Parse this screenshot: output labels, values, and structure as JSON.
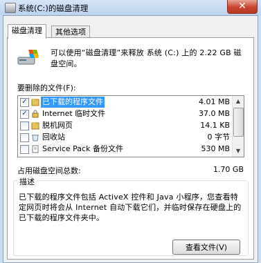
{
  "window": {
    "title": "系统(C:)的磁盘清理",
    "close_glyph": "✕"
  },
  "tabs": [
    {
      "label": "磁盘清理",
      "active": true
    },
    {
      "label": "其他选项",
      "active": false
    }
  ],
  "intro_text": "可以使用“磁盘清理”来释放 系统 (C:) 上的 2.22 GB 磁盘空间。",
  "files_label": "要删除的文件(F):",
  "files": [
    {
      "checked": true,
      "name": "已下载的程序文件",
      "size": "4.01 MB",
      "selected": true,
      "icon": "folder-icon"
    },
    {
      "checked": true,
      "name": "Internet 临时文件",
      "size": "37.0 MB",
      "selected": false,
      "icon": "lock-icon"
    },
    {
      "checked": false,
      "name": "脱机网页",
      "size": "14.1 KB",
      "selected": false,
      "icon": "folder-icon"
    },
    {
      "checked": false,
      "name": "回收站",
      "size": "0 字节",
      "selected": false,
      "icon": "recycle-bin-icon"
    },
    {
      "checked": false,
      "name": "Service Pack 备份文件",
      "size": "530 MB",
      "selected": false,
      "icon": "document-icon"
    }
  ],
  "total": {
    "label": "占用磁盘空间总数:",
    "value": "1.70 GB"
  },
  "description": {
    "label": "描述",
    "text": "已下载的程序文件包括 ActiveX 控件和 Java 小程序，您查看特定网页时将会从 Internet 自动下载它们，并临时保存在硬盘上的已下载的程序文件夹中。"
  },
  "view_files_button": "查看文件(V)",
  "colors": {
    "selection": "#3399ff",
    "titlebar": "#c9dcf2",
    "close_button": "#c9452f"
  }
}
